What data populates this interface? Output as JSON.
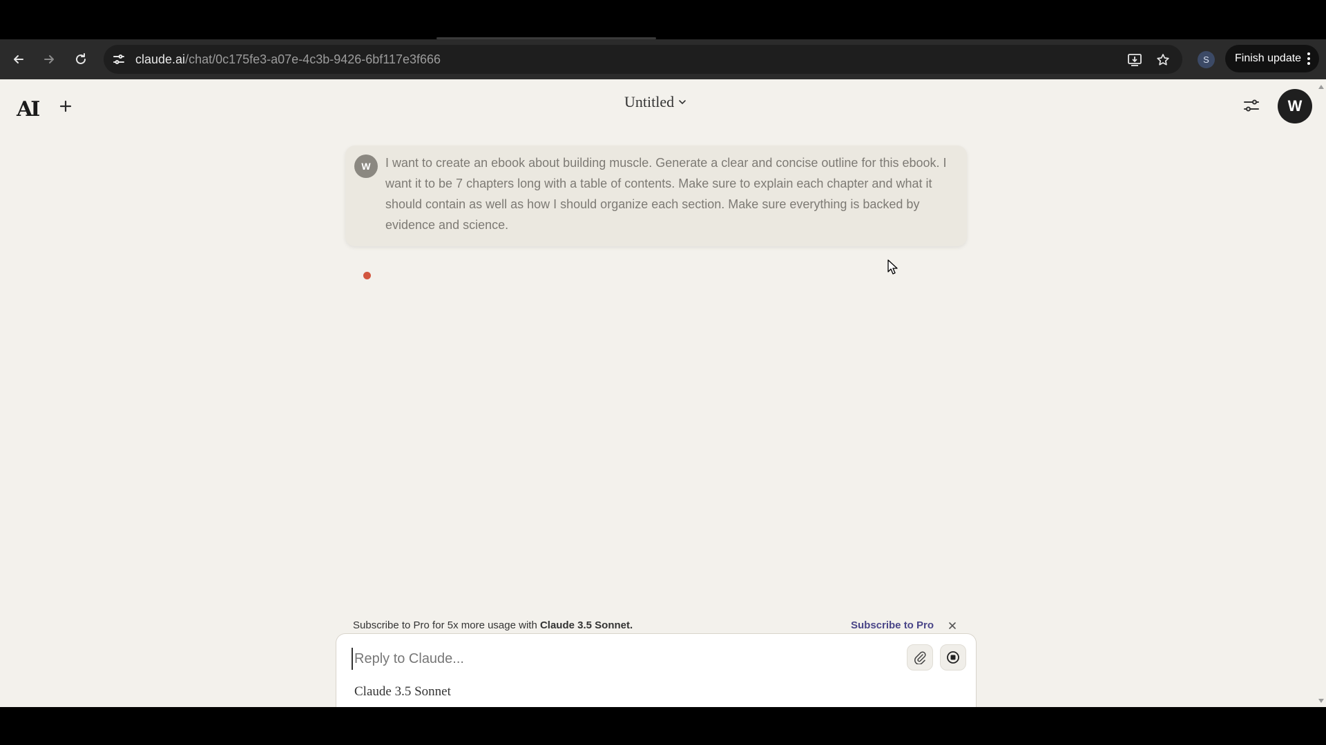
{
  "browser": {
    "url_host": "claude.ai",
    "url_path": "/chat/0c175fe3-a07e-4c3b-9426-6bf117e3f666",
    "profile_initial": "S",
    "finish_update_label": "Finish update"
  },
  "header": {
    "logo_text": "AI",
    "chat_title": "Untitled",
    "user_initial": "W"
  },
  "message": {
    "avatar_initial": "W",
    "text": "I want to create an ebook about building muscle. Generate a clear and concise outline for this ebook. I want it to be 7 chapters long with a table of contents. Make sure to explain each chapter and what it should contain as well as how I should organize each section. Make sure everything is backed by evidence and science."
  },
  "promo": {
    "prefix": "Subscribe to Pro for 5x more usage with ",
    "model": "Claude 3.5 Sonnet.",
    "link_label": "Subscribe to Pro"
  },
  "composer": {
    "placeholder": "Reply to Claude...",
    "model_label": "Claude 3.5 Sonnet"
  },
  "colors": {
    "page_bg": "#f3f1ec",
    "loading_dot": "#d2563f",
    "link": "#4a4688"
  }
}
